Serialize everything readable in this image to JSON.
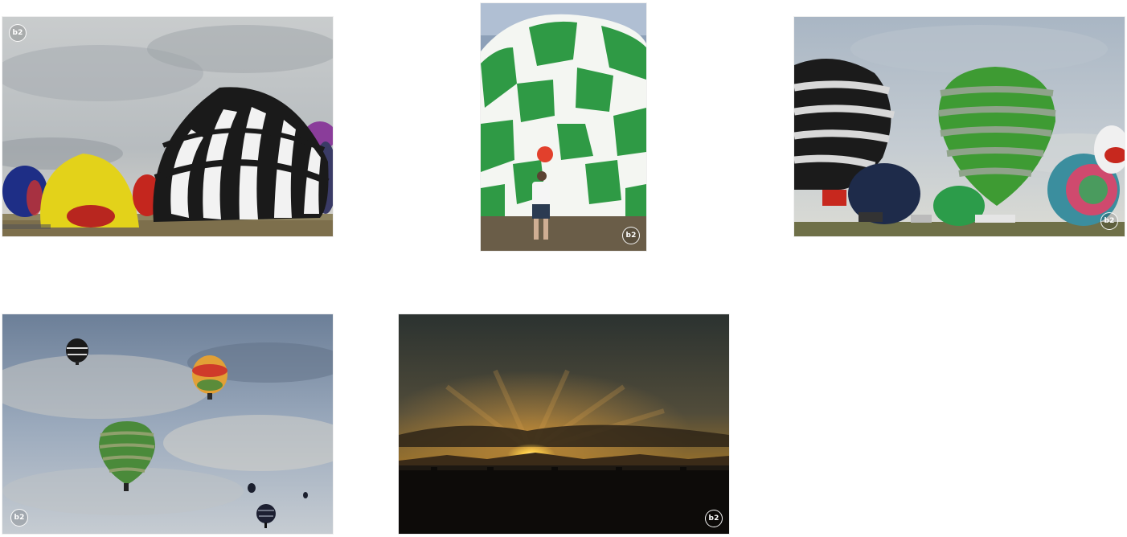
{
  "gallery": {
    "photos": [
      {
        "badge": "b2",
        "scene": "balloons-inflating-ground"
      },
      {
        "badge": "b2",
        "scene": "green-white-balloon-man"
      },
      {
        "badge": "b2",
        "scene": "balloons-field-cloudy"
      },
      {
        "badge": "b2",
        "scene": "balloons-in-sky"
      },
      {
        "badge": "b2",
        "scene": "sunset-silhouette"
      }
    ]
  },
  "colors": {
    "background": "#ffffff",
    "badge_border": "#ffffff"
  },
  "icons": {
    "badge": "b2-circle-badge-icon"
  }
}
